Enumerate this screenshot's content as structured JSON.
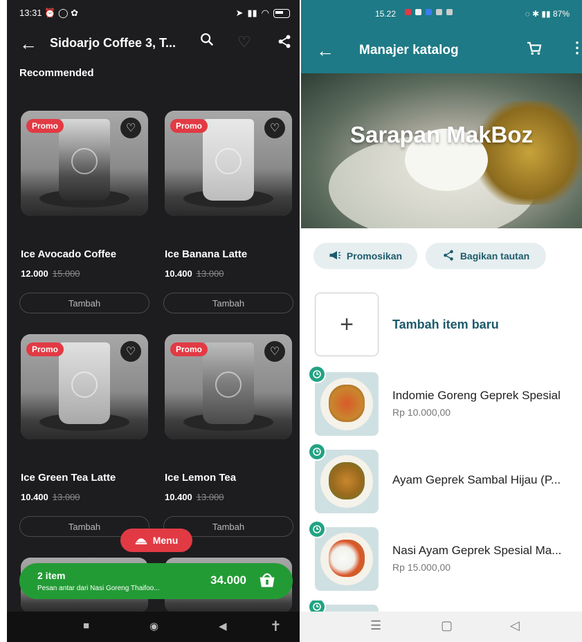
{
  "left": {
    "status": {
      "time": "13:31"
    },
    "topbar": {
      "title": "Sidoarjo Coffee 3, T..."
    },
    "section_title": "Recommended",
    "promo_label": "Promo",
    "add_label": "Tambah",
    "products": [
      {
        "name": "Ice Avocado Coffee",
        "price": "12.000",
        "old_price": "15.000"
      },
      {
        "name": "Ice Banana Latte",
        "price": "10.400",
        "old_price": "13.000"
      },
      {
        "name": "Ice Green Tea Latte",
        "price": "10.400",
        "old_price": "13.000"
      },
      {
        "name": "Ice Lemon Tea",
        "price": "10.400",
        "old_price": "13.000"
      }
    ],
    "menu_button": "Menu",
    "cart": {
      "count": "2 item",
      "subtitle": "Pesan antar dari Nasi Goreng Thaifoo...",
      "total": "34.000"
    },
    "colors": {
      "accent": "#e23a44",
      "cart": "#239b35",
      "background": "#1d1d1f"
    }
  },
  "right": {
    "status": {
      "time": "15.22",
      "battery": "87%"
    },
    "topbar": {
      "title": "Manajer katalog"
    },
    "hero_title": "Sarapan MakBoz",
    "actions": {
      "promote": "Promosikan",
      "share": "Bagikan tautan"
    },
    "add_item": "Tambah item baru",
    "items": [
      {
        "name": "Indomie Goreng Geprek Spesial",
        "price": "Rp 10.000,00"
      },
      {
        "name": "Ayam Geprek Sambal Hijau (P...",
        "price": ""
      },
      {
        "name": "Nasi Ayam Geprek Spesial Ma...",
        "price": "Rp 15.000,00"
      }
    ],
    "colors": {
      "primary": "#1e7a86",
      "badge": "#21a383"
    }
  }
}
